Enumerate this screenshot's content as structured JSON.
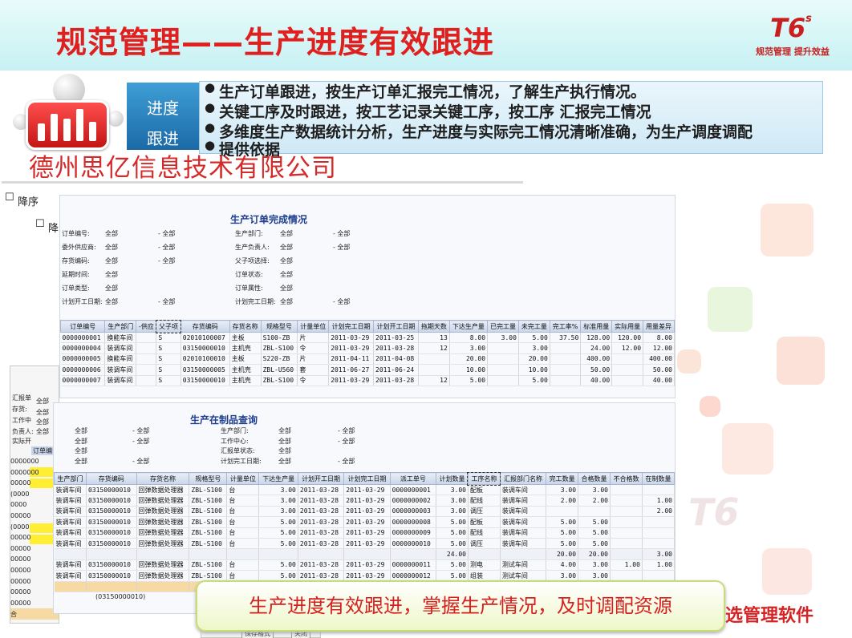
{
  "header": {
    "title": "规范管理——生产进度有效跟进",
    "logo": "T6",
    "logo_sup": "s",
    "slogan": "规范管理 提升效益"
  },
  "progress": {
    "tag_line1": "进度",
    "tag_line2": "跟进",
    "bullets": [
      "生产订单跟进，按生产订单汇报完工情况，了解生产执行情况。",
      "关键工序及时跟进，按工艺记录关键工序，按工序 汇报完工情况",
      "多维度生产数据统计分析，生产进度与实际完工情况清晰准确，为生产调度调配",
      "提供依据"
    ]
  },
  "company": "德州思亿信息技术有限公司",
  "back_shots": {
    "sort_label1": "降序",
    "sort_label2": "降",
    "left_labels": [
      "汇报单",
      "存货:",
      "工作中",
      "负责人:",
      "实际开"
    ],
    "left_values": [
      "全部",
      "全部",
      "全部",
      "全部"
    ],
    "left_header": "订单编号",
    "left_rows": [
      "0000000",
      "0000000",
      "00000",
      "(0000",
      "0000",
      "00000",
      "(0000",
      "00000",
      "00000",
      "00000",
      "00000",
      "00000",
      "00000",
      "00000",
      "合"
    ]
  },
  "report1": {
    "title": "生产订单完成情况",
    "filters_left": [
      {
        "label": "订单编号:",
        "value": "全部",
        "to": "- 全部"
      },
      {
        "label": "委外供应商:",
        "value": "全部",
        "to": "- 全部"
      },
      {
        "label": "存货编码:",
        "value": "全部",
        "to": "- 全部"
      },
      {
        "label": "延期时间:",
        "value": "全部",
        "to": ""
      },
      {
        "label": "订单类型:",
        "value": "全部",
        "to": ""
      },
      {
        "label": "计划开工日期:",
        "value": "全部",
        "to": "- 全部"
      }
    ],
    "filters_right": [
      {
        "label": "生产部门:",
        "value": "全部",
        "to": "- 全部"
      },
      {
        "label": "生产负责人:",
        "value": "全部",
        "to": "- 全部"
      },
      {
        "label": "父子项选择:",
        "value": "全部",
        "to": ""
      },
      {
        "label": "订单状态:",
        "value": "全部",
        "to": ""
      },
      {
        "label": "订单属性:",
        "value": "全部",
        "to": ""
      },
      {
        "label": "计划完工日期:",
        "value": "全部",
        "to": "- 全部"
      }
    ],
    "columns": [
      "订单编号",
      "生产部门",
      "-供应",
      "父子项",
      "存货编码",
      "存货名称",
      "规格型号",
      "计量单位",
      "计划完工日期",
      "计划开工日期",
      "拖期天数",
      "下达生产量",
      "已完工量",
      "未完工量",
      "完工率%",
      "标准用量",
      "实际用量",
      "用量差异"
    ],
    "rows": [
      [
        "0000000001",
        "换能车间",
        "",
        "S",
        "02010100007",
        "主板",
        "S100-ZB",
        "片",
        "2011-03-29",
        "2011-03-25",
        "13",
        "8.00",
        "3.00",
        "5.00",
        "37.50",
        "128.00",
        "120.00",
        "8.00"
      ],
      [
        "0000000004",
        "装调车间",
        "",
        "S",
        "03150000010",
        "主机壳",
        "ZBL-S100",
        "令",
        "2011-03-29",
        "2011-03-28",
        "12",
        "3.00",
        "",
        "3.00",
        "",
        "24.00",
        "12.00",
        "12.00"
      ],
      [
        "0000000005",
        "换能车间",
        "",
        "S",
        "02010100010",
        "主板",
        "S220-ZB",
        "片",
        "2011-04-11",
        "2011-04-08",
        "",
        "20.00",
        "",
        "20.00",
        "",
        "400.00",
        "",
        "400.00"
      ],
      [
        "0000000006",
        "装调车间",
        "",
        "S",
        "03150000005",
        "主机壳",
        "ZBL-U560",
        "套",
        "2011-06-27",
        "2011-06-24",
        "",
        "10.00",
        "",
        "10.00",
        "",
        "50.00",
        "",
        "50.00"
      ],
      [
        "0000000007",
        "装调车间",
        "",
        "S",
        "03150000010",
        "主机壳",
        "ZBL-S100",
        "令",
        "2011-03-29",
        "2011-03-28",
        "12",
        "5.00",
        "",
        "5.00",
        "",
        "40.00",
        "",
        "40.00"
      ]
    ]
  },
  "report2": {
    "title": "生产在制品查询",
    "filters_left": [
      {
        "value": "全部",
        "to": "- 全部"
      },
      {
        "value": "全部",
        "to": "- 全部"
      },
      {
        "value": "全部",
        "to": ""
      },
      {
        "value": "全部",
        "to": "- 全部"
      }
    ],
    "filters_right": [
      {
        "label": "生产部门:",
        "value": "全部",
        "to": "- 全部"
      },
      {
        "label": "工作中心:",
        "value": "全部",
        "to": "- 全部"
      },
      {
        "label": "汇报单状态:",
        "value": "全部",
        "to": ""
      },
      {
        "label": "计划完工日期:",
        "value": "全部",
        "to": "- 全部"
      }
    ],
    "columns": [
      "生产部门",
      "存货编码",
      "存货名称",
      "规格型号",
      "计量单位",
      "下达生产量",
      "计划开工日期",
      "计划完工日期",
      "派工单号",
      "计划数量",
      "工序名称",
      "汇报部门名称",
      "完工数量",
      "合格数量",
      "不合格数",
      "在制数量"
    ],
    "rows": [
      [
        "装调车间",
        "03150000010",
        "回弹数据处理器",
        "ZBL-S100",
        "台",
        "3.00",
        "2011-03-28",
        "2011-03-29",
        "0000000001",
        "3.00",
        "配板",
        "装调车间",
        "3.00",
        "3.00",
        "",
        ""
      ],
      [
        "装调车间",
        "03150000010",
        "回弹数据处理器",
        "ZBL-S100",
        "台",
        "3.00",
        "2011-03-28",
        "2011-03-29",
        "0000000002",
        "3.00",
        "配线",
        "装调车间",
        "2.00",
        "2.00",
        "",
        "1.00"
      ],
      [
        "装调车间",
        "03150000010",
        "回弹数据处理器",
        "ZBL-S100",
        "台",
        "3.00",
        "2011-03-28",
        "2011-03-29",
        "0000000003",
        "3.00",
        "调压",
        "装调车间",
        "",
        "",
        "",
        "2.00"
      ],
      [
        "装调车间",
        "03150000010",
        "回弹数据处理器",
        "ZBL-S100",
        "台",
        "5.00",
        "2011-03-28",
        "2011-03-29",
        "0000000008",
        "5.00",
        "配板",
        "装调车间",
        "5.00",
        "5.00",
        "",
        ""
      ],
      [
        "装调车间",
        "03150000010",
        "回弹数据处理器",
        "ZBL-S100",
        "台",
        "5.00",
        "2011-03-28",
        "2011-03-29",
        "0000000009",
        "5.00",
        "配线",
        "装调车间",
        "5.00",
        "5.00",
        "",
        ""
      ],
      [
        "装调车间",
        "03150000010",
        "回弹数据处理器",
        "ZBL-S100",
        "台",
        "5.00",
        "2011-03-28",
        "2011-03-29",
        "0000000010",
        "5.00",
        "调压",
        "装调车间",
        "5.00",
        "5.00",
        "",
        ""
      ],
      [
        "",
        "",
        "",
        "",
        "",
        "",
        "",
        "",
        "",
        "24.00",
        "",
        "",
        "20.00",
        "20.00",
        "",
        "3.00"
      ],
      [
        "装调车间",
        "03150000010",
        "回弹数据处理器",
        "ZBL-S100",
        "台",
        "5.00",
        "2011-03-28",
        "2011-03-29",
        "0000000011",
        "5.00",
        "测电",
        "测试车间",
        "4.00",
        "3.00",
        "1.00",
        "1.00"
      ],
      [
        "装调车间",
        "03150000010",
        "回弹数据处理器",
        "ZBL-S100",
        "台",
        "5.00",
        "2011-03-28",
        "2011-03-29",
        "0000000012",
        "5.00",
        "组装",
        "测试车间",
        "3.00",
        "3.00",
        "",
        ""
      ]
    ],
    "footer_code": "(03150000010)"
  },
  "dialog_buttons": {
    "save": "保存格式",
    "close": "关闭"
  },
  "banner": "生产进度有效跟进，掌握生产情况，及时调配资源",
  "bottom_right": "选管理软件",
  "watermark": "T6",
  "colors": {
    "title_red": "#e0201e",
    "header_bg": "#c7f1f3",
    "tag_blue": "#2a83c2",
    "highlight_yellow": "#ffee33"
  }
}
